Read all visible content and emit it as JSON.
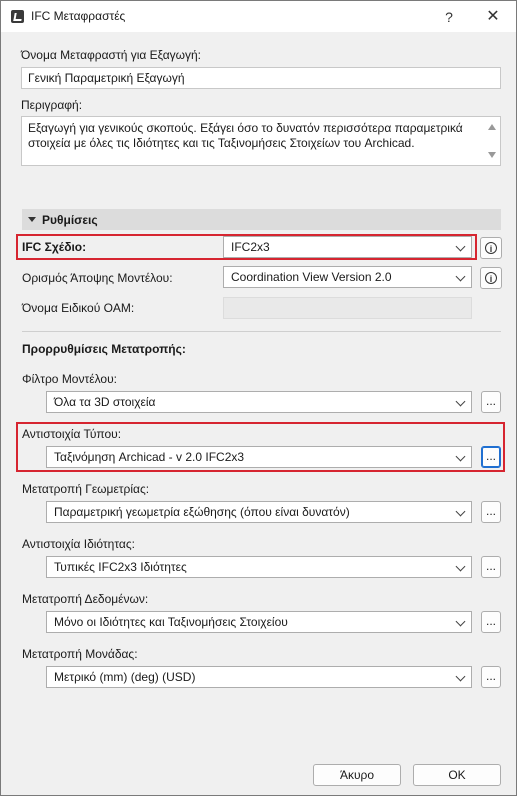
{
  "window": {
    "title": "IFC Μεταφραστές",
    "help_label": "?",
    "close_label": "✕"
  },
  "export_name": {
    "label": "Όνομα Μεταφραστή για Εξαγωγή:",
    "value": "Γενική Παραμετρική Εξαγωγή"
  },
  "description": {
    "label": "Περιγραφή:",
    "value": "Εξαγωγή για γενικούς σκοπούς. Εξάγει όσο το δυνατόν περισσότερα παραμετρικά στοιχεία με όλες τις Ιδιότητες και τις Ταξινομήσεις Στοιχείων του Archicad."
  },
  "settings": {
    "header": "Ρυθμίσεις",
    "ifc_schema": {
      "label": "IFC Σχέδιο:",
      "value": "IFC2x3"
    },
    "model_view": {
      "label": "Ορισμός Άποψης Μοντέλου:",
      "value": "Coordination View Version 2.0"
    },
    "oam_name": {
      "label": "Όνομα Ειδικού OAM:",
      "value": ""
    }
  },
  "presets": {
    "header": "Προρρυθμίσεις Μετατροπής:",
    "model_filter": {
      "label": "Φίλτρο Μοντέλου:",
      "value": "Όλα τα 3D στοιχεία"
    },
    "type_mapping": {
      "label": "Αντιστοιχία Τύπου:",
      "value": "Ταξινόμηση Archicad - v 2.0 IFC2x3"
    },
    "geometry": {
      "label": "Μετατροπή Γεωμετρίας:",
      "value": "Παραμετρική γεωμετρία εξώθησης (όπου είναι δυνατόν)"
    },
    "property_mapping": {
      "label": "Αντιστοιχία Ιδιότητας:",
      "value": "Τυπικές IFC2x3 Ιδιότητες"
    },
    "data_conversion": {
      "label": "Μετατροπή Δεδομένων:",
      "value": "Μόνο οι Ιδιότητες και Ταξινομήσεις Στοιχείου"
    },
    "unit_conversion": {
      "label": "Μετατροπή Μονάδας:",
      "value": "Μετρικό (mm) (deg) (USD)"
    },
    "dots_label": "..."
  },
  "buttons": {
    "cancel": "Άκυρο",
    "ok": "OK"
  },
  "colors": {
    "highlight": "#d62530",
    "focus": "#1f6fd1"
  }
}
